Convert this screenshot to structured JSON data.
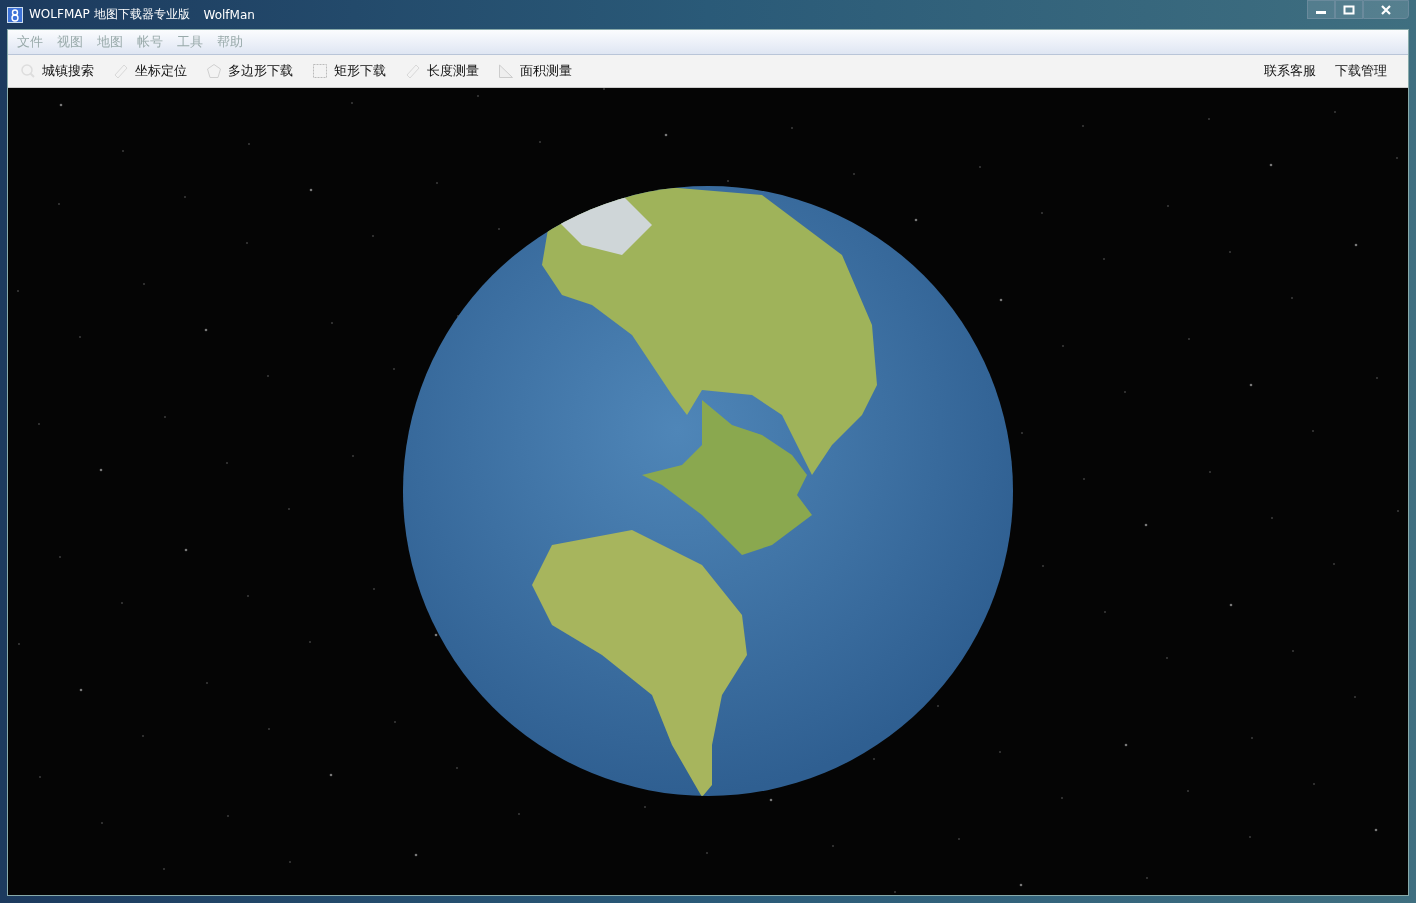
{
  "window": {
    "title": "WOLFMAP 地图下载器专业版",
    "user": "WolfMan"
  },
  "menu": [
    "文件",
    "视图",
    "地图",
    "帐号",
    "工具",
    "帮助"
  ],
  "toolbar": [
    {
      "label": "城镇搜索",
      "kind": "search"
    },
    {
      "label": "坐标定位",
      "kind": "ruler"
    },
    {
      "label": "多边形下载",
      "kind": "polygon"
    },
    {
      "label": "矩形下载",
      "kind": "rectangle"
    },
    {
      "label": "长度测量",
      "kind": "ruler"
    },
    {
      "label": "面积测量",
      "kind": "area"
    }
  ],
  "toolbar_right": [
    "联系客服",
    "下载管理"
  ]
}
